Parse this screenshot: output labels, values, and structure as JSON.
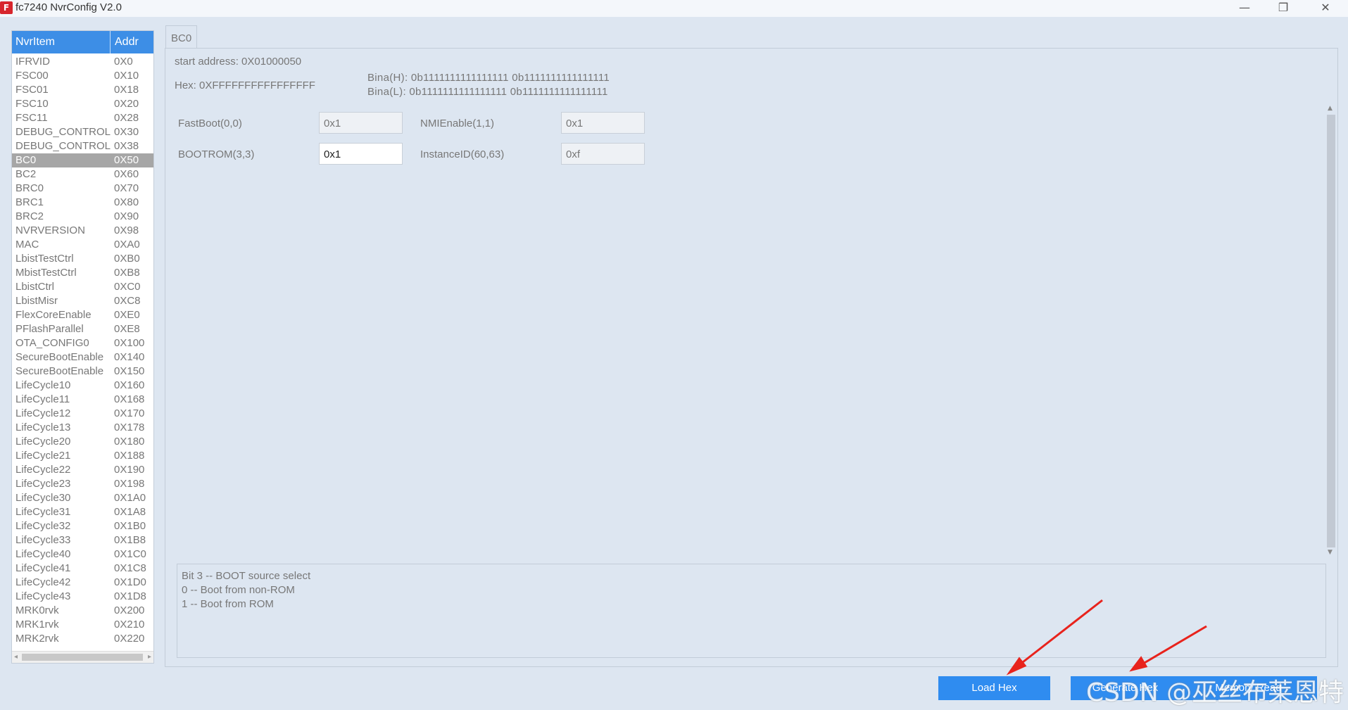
{
  "window": {
    "title": "fc7240 NvrConfig V2.0",
    "minimize": "—",
    "restore": "❐",
    "close": "✕",
    "icon_letter": "F"
  },
  "list": {
    "header_name": "NvrItem",
    "header_addr": "Addr",
    "selected_index": 7,
    "items": [
      {
        "name": "IFRVID",
        "addr": "0X0"
      },
      {
        "name": "FSC00",
        "addr": "0X10"
      },
      {
        "name": "FSC01",
        "addr": "0X18"
      },
      {
        "name": "FSC10",
        "addr": "0X20"
      },
      {
        "name": "FSC11",
        "addr": "0X28"
      },
      {
        "name": "DEBUG_CONTROL",
        "addr": "0X30"
      },
      {
        "name": "DEBUG_CONTROL",
        "addr": "0X38"
      },
      {
        "name": "BC0",
        "addr": "0X50"
      },
      {
        "name": "BC2",
        "addr": "0X60"
      },
      {
        "name": "BRC0",
        "addr": "0X70"
      },
      {
        "name": "BRC1",
        "addr": "0X80"
      },
      {
        "name": "BRC2",
        "addr": "0X90"
      },
      {
        "name": "NVRVERSION",
        "addr": "0X98"
      },
      {
        "name": "MAC",
        "addr": "0XA0"
      },
      {
        "name": "LbistTestCtrl",
        "addr": "0XB0"
      },
      {
        "name": "MbistTestCtrl",
        "addr": "0XB8"
      },
      {
        "name": "LbistCtrl",
        "addr": "0XC0"
      },
      {
        "name": "LbistMisr",
        "addr": "0XC8"
      },
      {
        "name": "FlexCoreEnable",
        "addr": "0XE0"
      },
      {
        "name": "PFlashParallel",
        "addr": "0XE8"
      },
      {
        "name": "OTA_CONFIG0",
        "addr": "0X100"
      },
      {
        "name": "SecureBootEnable",
        "addr": "0X140"
      },
      {
        "name": "SecureBootEnable",
        "addr": "0X150"
      },
      {
        "name": "LifeCycle10",
        "addr": "0X160"
      },
      {
        "name": "LifeCycle11",
        "addr": "0X168"
      },
      {
        "name": "LifeCycle12",
        "addr": "0X170"
      },
      {
        "name": "LifeCycle13",
        "addr": "0X178"
      },
      {
        "name": "LifeCycle20",
        "addr": "0X180"
      },
      {
        "name": "LifeCycle21",
        "addr": "0X188"
      },
      {
        "name": "LifeCycle22",
        "addr": "0X190"
      },
      {
        "name": "LifeCycle23",
        "addr": "0X198"
      },
      {
        "name": "LifeCycle30",
        "addr": "0X1A0"
      },
      {
        "name": "LifeCycle31",
        "addr": "0X1A8"
      },
      {
        "name": "LifeCycle32",
        "addr": "0X1B0"
      },
      {
        "name": "LifeCycle33",
        "addr": "0X1B8"
      },
      {
        "name": "LifeCycle40",
        "addr": "0X1C0"
      },
      {
        "name": "LifeCycle41",
        "addr": "0X1C8"
      },
      {
        "name": "LifeCycle42",
        "addr": "0X1D0"
      },
      {
        "name": "LifeCycle43",
        "addr": "0X1D8"
      },
      {
        "name": "MRK0rvk",
        "addr": "0X200"
      },
      {
        "name": "MRK1rvk",
        "addr": "0X210"
      },
      {
        "name": "MRK2rvk",
        "addr": "0X220"
      }
    ]
  },
  "tab": {
    "label": "BC0"
  },
  "info": {
    "start_address": "start address: 0X01000050",
    "hex": "Hex: 0XFFFFFFFFFFFFFFFF",
    "bina_h": "Bina(H): 0b1111111111111111 0b1111111111111111",
    "bina_l": "Bina(L): 0b1111111111111111 0b1111111111111111"
  },
  "fields": [
    {
      "label": "FastBoot(0,0)",
      "value": "0x1"
    },
    {
      "label": "NMIEnable(1,1)",
      "value": "0x1"
    },
    {
      "label": "BOOTROM(3,3)",
      "value": "0x1"
    },
    {
      "label": "InstanceID(60,63)",
      "value": "0xf"
    }
  ],
  "description": {
    "lines": [
      "Bit 3 -- BOOT source select",
      "0 -- Boot from non-ROM",
      "1 -- Boot from ROM"
    ]
  },
  "buttons": {
    "load_hex": "Load Hex",
    "generate_hex": "Generate Hex",
    "memory_read": "Memory Read"
  },
  "watermark": "CSDN @巫丝布莱恩特",
  "colors": {
    "accent": "#2f8cf0",
    "header": "#3d8ee6",
    "selected_row": "#a6a6a6",
    "background": "#dde6f1",
    "arrow": "#e8231c"
  }
}
